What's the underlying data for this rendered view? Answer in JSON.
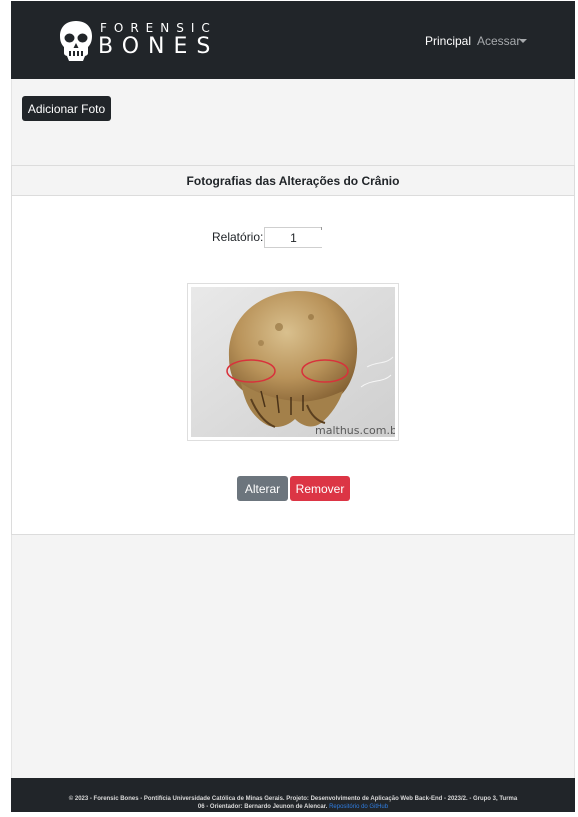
{
  "brand": {
    "name_top": "FORENSIC",
    "name_bottom": "BONES",
    "icon": "skull-icon"
  },
  "nav": {
    "principal": "Principal",
    "acessar": "Acessar"
  },
  "actions": {
    "add_photo": "Adicionar Foto"
  },
  "card": {
    "title": "Fotografias das Alterações do Crânio",
    "relatorio_label": "Relatório:",
    "relatorio_value": "1",
    "photo_watermark": "malthus.com.br",
    "alter_button": "Alterar",
    "remove_button": "Remover"
  },
  "footer": {
    "line1": "© 2023 - Forensic Bones - Pontifícia Universidade Católica de Minas Gerais. Projeto: Desenvolvimento de Aplicação Web Back-End - 2023/2. - Grupo 3, Turma",
    "line2": "06 - Orientador: Bernardo Jeunon de Alencar.",
    "link": "Repositório do GitHub"
  },
  "colors": {
    "navbar": "#212529",
    "secondary": "#6c757d",
    "danger": "#dc3545",
    "link": "#2f7de1"
  }
}
